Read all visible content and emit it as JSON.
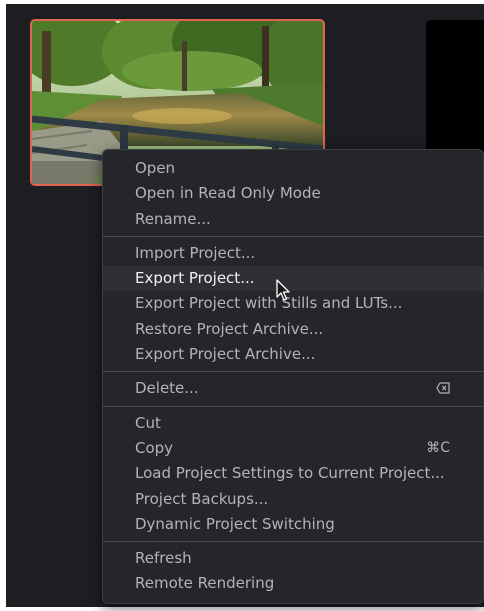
{
  "thumbnail": {
    "selected": true,
    "accent_color": "#e06350",
    "image_description_icon": "project-thumbnail-icon"
  },
  "menu": {
    "groups": [
      [
        {
          "label": "Open"
        },
        {
          "label": "Open in Read Only Mode"
        },
        {
          "label": "Rename..."
        }
      ],
      [
        {
          "label": "Import Project..."
        },
        {
          "label": "Export Project..."
        },
        {
          "label": "Export Project with Stills and LUTs..."
        },
        {
          "label": "Restore Project Archive..."
        },
        {
          "label": "Export Project Archive..."
        }
      ],
      [
        {
          "label": "Delete...",
          "shortcut_icon": "delete-key-icon"
        }
      ],
      [
        {
          "label": "Cut"
        },
        {
          "label": "Copy",
          "shortcut": "⌘C"
        },
        {
          "label": "Load Project Settings to Current Project..."
        },
        {
          "label": "Project Backups..."
        },
        {
          "label": "Dynamic Project Switching"
        }
      ],
      [
        {
          "label": "Refresh"
        },
        {
          "label": "Remote Rendering"
        }
      ]
    ],
    "hovered_item": "Export Project..."
  },
  "colors": {
    "background": "#1d1e22",
    "menu_background": "#252629",
    "menu_text": "#b4b4b6",
    "hover_background": "#2f3034",
    "selection_border": "#e06350"
  }
}
